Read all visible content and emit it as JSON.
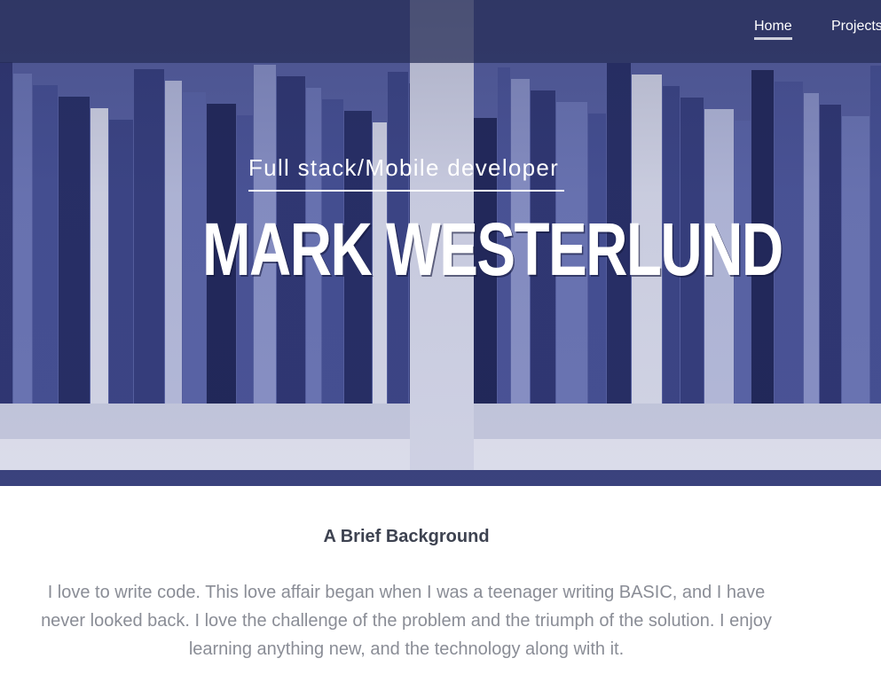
{
  "nav": {
    "items": [
      {
        "label": "Home",
        "active": true
      },
      {
        "label": "Projects",
        "active": false
      }
    ]
  },
  "hero": {
    "subtitle": "Full stack/Mobile developer",
    "title": "MARK WESTERLUND",
    "background": "bookshelf-photo",
    "tint_color": "#565f9f"
  },
  "background_section": {
    "heading": "A Brief Background",
    "lines": [
      "I love to write code. This love affair began when I was a teenager writing BASIC, and I have",
      "never looked back. I love the challenge of the problem and the triumph of the solution. I enjoy",
      "learning anything new, and the technology along with it."
    ]
  }
}
